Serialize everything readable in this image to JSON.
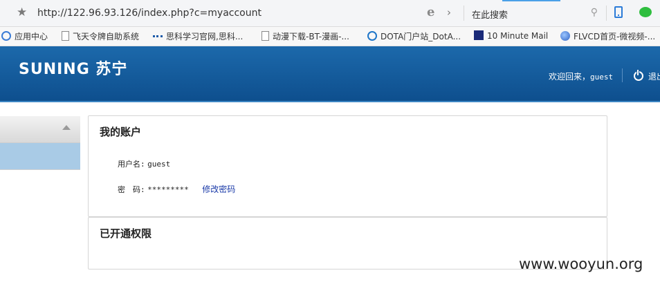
{
  "browser": {
    "url": "http://122.96.93.126/index.php?c=myaccount",
    "search_placeholder": "在此搜索"
  },
  "bookmarks": [
    {
      "label": "应用中心",
      "icon": "app-center-icon"
    },
    {
      "label": "飞天令牌自助系统",
      "icon": "page-icon"
    },
    {
      "label": "思科学习官网,思科...",
      "icon": "cisco-icon"
    },
    {
      "label": "动漫下载-BT-漫画-...",
      "icon": "page-icon"
    },
    {
      "label": "DOTA门户站_DotA...",
      "icon": "dota-icon"
    },
    {
      "label": "10 Minute Mail",
      "icon": "tenminutemail-icon"
    },
    {
      "label": "FLVCD首页-微视频-...",
      "icon": "flvcd-icon"
    }
  ],
  "header": {
    "logo_text": "SUNING 苏宁",
    "welcome_prefix": "欢迎回来，",
    "username": "guest",
    "logout_label": "退出"
  },
  "account": {
    "title": "我的账户",
    "username_label": "用户名:",
    "username_value": "guest",
    "password_label": "密　码:",
    "password_value": "*********",
    "change_password": "修改密码"
  },
  "permissions": {
    "title": "已开通权限"
  },
  "watermark": "www.wooyun.org",
  "colors": {
    "header_blue": "#135a9b",
    "sidebar_selected": "#a9cbe6",
    "link": "#1a3aa8"
  }
}
